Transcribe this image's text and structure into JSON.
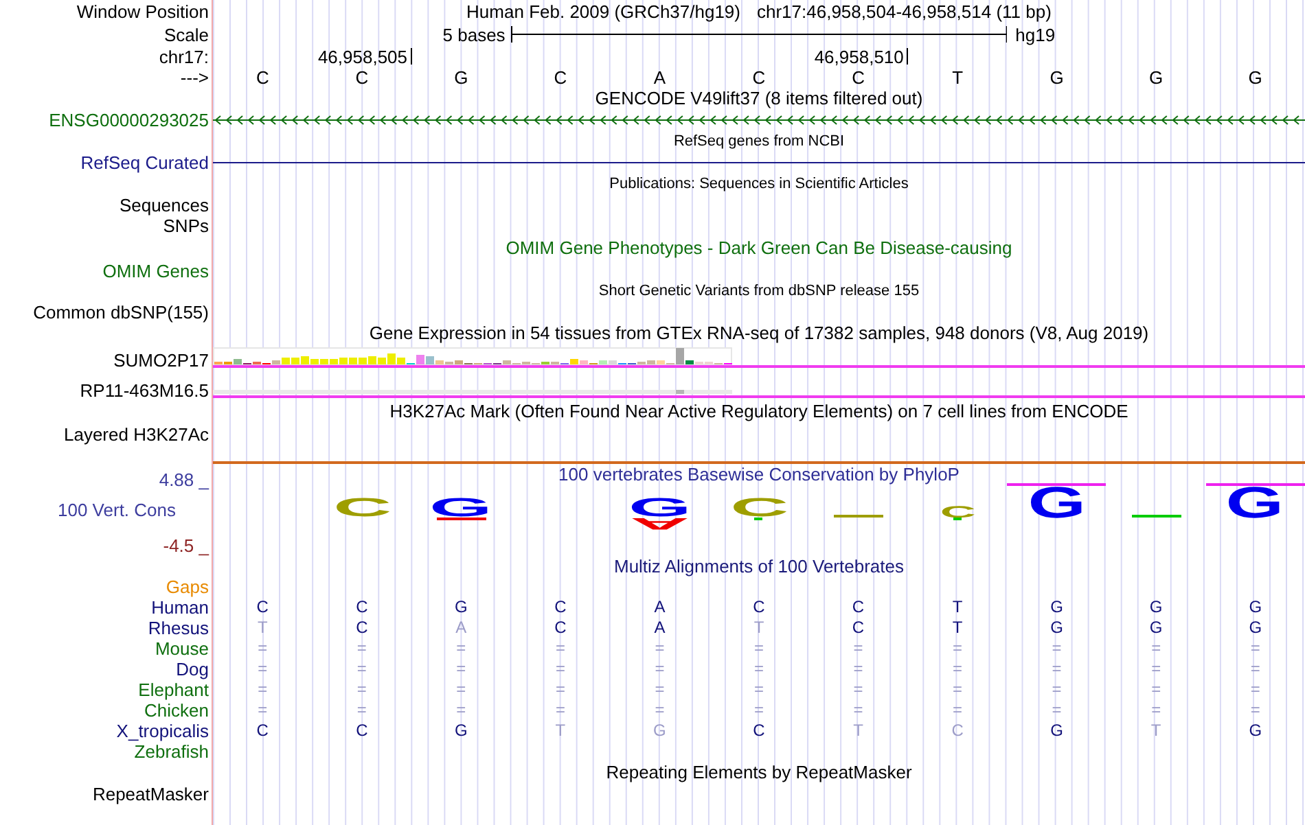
{
  "header": {
    "labels": [
      "Window Position",
      "Scale",
      "chr17:",
      "--->"
    ],
    "assembly": "Human Feb. 2009 (GRCh37/hg19)",
    "position": "chr17:46,958,504-46,958,514 (11 bp)",
    "scale_label": "5 bases",
    "scale_db": "hg19",
    "bases": [
      {
        "base": "C"
      },
      {
        "base": "C",
        "tick": "46,958,505"
      },
      {
        "base": "G"
      },
      {
        "base": "C"
      },
      {
        "base": "A"
      },
      {
        "base": "C"
      },
      {
        "base": "C",
        "tick": "46,958,510"
      },
      {
        "base": "T"
      },
      {
        "base": "G"
      },
      {
        "base": "G"
      },
      {
        "base": "G"
      }
    ]
  },
  "tracks": [
    {
      "kind": "gene",
      "title": {
        "text": "GENCODE V49lift37 (8 items filtered out)",
        "color": "#000000"
      },
      "labels": [
        {
          "text": "ENSG00000293025",
          "color": "#0f6f0f"
        }
      ]
    },
    {
      "kind": "refseq",
      "title": {
        "text": "RefSeq genes from NCBI",
        "color": "#000000"
      },
      "labels": [
        {
          "text": "RefSeq Curated",
          "color": "#1b1b8a"
        }
      ]
    },
    {
      "kind": "publications",
      "title": {
        "text": "Publications: Sequences in Scientific Articles",
        "color": "#000000"
      },
      "labels": [
        {
          "text": "Sequences",
          "color": "#000000"
        },
        {
          "text": "SNPs",
          "color": "#000000"
        }
      ]
    },
    {
      "kind": "omim",
      "title": {
        "text": "OMIM Gene Phenotypes - Dark Green Can Be Disease-causing",
        "color": "#0f6f0f"
      },
      "labels": [
        {
          "text": "OMIM Genes",
          "color": "#0f6f0f"
        }
      ]
    },
    {
      "kind": "dbsnp",
      "title": {
        "text": "Short Genetic Variants from dbSNP release 155",
        "color": "#000000"
      },
      "labels": [
        {
          "text": "Common dbSNP(155)",
          "color": "#000000"
        }
      ]
    },
    {
      "kind": "expression",
      "title": {
        "text": "Gene Expression in 54 tissues from GTEx RNA-seq of 17382 samples, 948 donors (V8, Aug 2019)",
        "color": "#000000"
      },
      "labels": [
        {
          "text": "SUMO2P17",
          "color": "#000000",
          "kind": "bars"
        },
        {
          "text": "RP11-463M16.5",
          "color": "#000000",
          "kind": "trace"
        }
      ]
    },
    {
      "kind": "signal",
      "title": {
        "text": "H3K27Ac Mark (Often Found Near Active Regulatory Elements) on 7 cell lines from ENCODE",
        "color": "#000000"
      },
      "labels": [
        {
          "text": "Layered H3K27Ac",
          "color": "#000000"
        }
      ]
    },
    {
      "kind": "conservation",
      "title": {
        "text": "100 vertebrates Basewise Conservation by PhyloP",
        "color": "#2e2e96"
      },
      "labels": [
        {
          "text": "100 Vert. Cons",
          "color": "#3d3d9e"
        }
      ],
      "axis": [
        {
          "text": "4.88 _",
          "color": "#3d3d9e"
        },
        {
          "text": "-4.5 _",
          "color": "#8e2424"
        }
      ],
      "logo": [
        {
          "kind": "none"
        },
        {
          "kind": "medium",
          "text": "C",
          "color": "#9e9e00"
        },
        {
          "kind": "medium",
          "text": "G",
          "color": "#0000f0",
          "below": {
            "kind": "dash",
            "color": "#f00000"
          }
        },
        {
          "kind": "none"
        },
        {
          "kind": "medium",
          "text": "G",
          "color": "#0000f0",
          "below": {
            "kind": "small",
            "text": "A",
            "color": "#f00000"
          }
        },
        {
          "kind": "medium",
          "text": "C",
          "color": "#9e9e00",
          "below": {
            "kind": "dot",
            "color": "#00cc00"
          }
        },
        {
          "kind": "dash",
          "color": "#9e9e00"
        },
        {
          "kind": "small",
          "text": "C",
          "color": "#9e9e00",
          "below": {
            "kind": "dot",
            "color": "#00cc00"
          }
        },
        {
          "kind": "clipped",
          "text": "G",
          "color": "#0000f0"
        },
        {
          "kind": "dash",
          "color": "#00cc00"
        },
        {
          "kind": "clipped",
          "text": "G",
          "color": "#0000f0"
        }
      ]
    },
    {
      "kind": "alignment",
      "title": {
        "text": "Multiz Alignments of 100 Vertebrates",
        "color": "#1a1a7a"
      },
      "species": [
        {
          "name": "Gaps",
          "color": "#e88a00"
        },
        {
          "name": "Human",
          "color": "#12127a",
          "bases": [
            {
              "text": "C",
              "faded": false
            },
            {
              "text": "C",
              "faded": false
            },
            {
              "text": "G",
              "faded": false
            },
            {
              "text": "C",
              "faded": false
            },
            {
              "text": "A",
              "faded": false
            },
            {
              "text": "C",
              "faded": false
            },
            {
              "text": "C",
              "faded": false
            },
            {
              "text": "T",
              "faded": false
            },
            {
              "text": "G",
              "faded": false
            },
            {
              "text": "G",
              "faded": false
            },
            {
              "text": "G",
              "faded": false
            }
          ]
        },
        {
          "name": "Rhesus",
          "color": "#12127a",
          "bases": [
            {
              "text": "T",
              "faded": true
            },
            {
              "text": "C",
              "faded": false
            },
            {
              "text": "A",
              "faded": true
            },
            {
              "text": "C",
              "faded": false
            },
            {
              "text": "A",
              "faded": false
            },
            {
              "text": "T",
              "faded": true
            },
            {
              "text": "C",
              "faded": false
            },
            {
              "text": "T",
              "faded": false
            },
            {
              "text": "G",
              "faded": false
            },
            {
              "text": "G",
              "faded": false
            },
            {
              "text": "G",
              "faded": false
            }
          ]
        },
        {
          "name": "Mouse",
          "color": "#0f6f0f",
          "bases": [
            {
              "text": "=",
              "faded": true
            },
            {
              "text": "=",
              "faded": true
            },
            {
              "text": "=",
              "faded": true
            },
            {
              "text": "=",
              "faded": true
            },
            {
              "text": "=",
              "faded": true
            },
            {
              "text": "=",
              "faded": true
            },
            {
              "text": "=",
              "faded": true
            },
            {
              "text": "=",
              "faded": true
            },
            {
              "text": "=",
              "faded": true
            },
            {
              "text": "=",
              "faded": true
            },
            {
              "text": "=",
              "faded": true
            }
          ]
        },
        {
          "name": "Dog",
          "color": "#12127a",
          "bases": [
            {
              "text": "=",
              "faded": true
            },
            {
              "text": "=",
              "faded": true
            },
            {
              "text": "=",
              "faded": true
            },
            {
              "text": "=",
              "faded": true
            },
            {
              "text": "=",
              "faded": true
            },
            {
              "text": "=",
              "faded": true
            },
            {
              "text": "=",
              "faded": true
            },
            {
              "text": "=",
              "faded": true
            },
            {
              "text": "=",
              "faded": true
            },
            {
              "text": "=",
              "faded": true
            },
            {
              "text": "=",
              "faded": true
            }
          ]
        },
        {
          "name": "Elephant",
          "color": "#0f6f0f",
          "bases": [
            {
              "text": "=",
              "faded": true
            },
            {
              "text": "=",
              "faded": true
            },
            {
              "text": "=",
              "faded": true
            },
            {
              "text": "=",
              "faded": true
            },
            {
              "text": "=",
              "faded": true
            },
            {
              "text": "=",
              "faded": true
            },
            {
              "text": "=",
              "faded": true
            },
            {
              "text": "=",
              "faded": true
            },
            {
              "text": "=",
              "faded": true
            },
            {
              "text": "=",
              "faded": true
            },
            {
              "text": "=",
              "faded": true
            }
          ]
        },
        {
          "name": "Chicken",
          "color": "#0f6f0f",
          "bases": [
            {
              "text": "=",
              "faded": true
            },
            {
              "text": "=",
              "faded": true
            },
            {
              "text": "=",
              "faded": true
            },
            {
              "text": "=",
              "faded": true
            },
            {
              "text": "=",
              "faded": true
            },
            {
              "text": "=",
              "faded": true
            },
            {
              "text": "=",
              "faded": true
            },
            {
              "text": "=",
              "faded": true
            },
            {
              "text": "=",
              "faded": true
            },
            {
              "text": "=",
              "faded": true
            },
            {
              "text": "=",
              "faded": true
            }
          ]
        },
        {
          "name": "X_tropicalis",
          "color": "#12127a",
          "bases": [
            {
              "text": "C",
              "faded": false
            },
            {
              "text": "C",
              "faded": false
            },
            {
              "text": "G",
              "faded": false
            },
            {
              "text": "T",
              "faded": true
            },
            {
              "text": "G",
              "faded": true
            },
            {
              "text": "C",
              "faded": false
            },
            {
              "text": "T",
              "faded": true
            },
            {
              "text": "C",
              "faded": true
            },
            {
              "text": "G",
              "faded": false
            },
            {
              "text": "T",
              "faded": true
            },
            {
              "text": "G",
              "faded": false
            }
          ]
        },
        {
          "name": "Zebrafish",
          "color": "#0f6f0f"
        }
      ]
    },
    {
      "kind": "repeats",
      "title": {
        "text": "Repeating Elements by RepeatMasker",
        "color": "#000000"
      },
      "labels": [
        {
          "text": "RepeatMasker",
          "color": "#000000"
        }
      ]
    }
  ]
}
